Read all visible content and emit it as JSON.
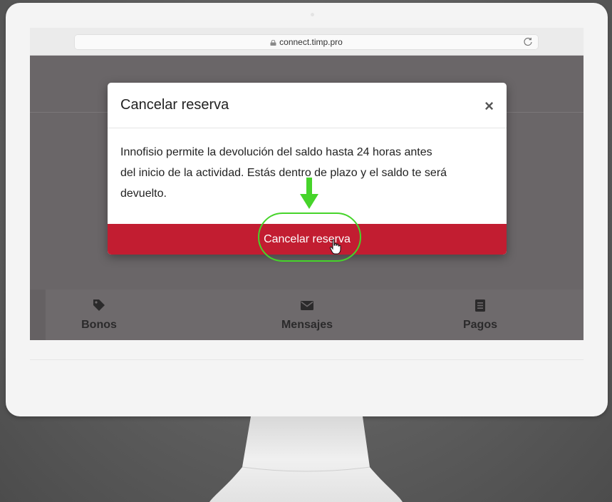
{
  "browser": {
    "url": "connect.timp.pro",
    "lock_icon": "lock-icon",
    "reload_icon": "reload-icon"
  },
  "modal": {
    "title": "Cancelar reserva",
    "close_label": "×",
    "body_lines": [
      "Innofisio permite la devolución del saldo hasta 24 horas antes",
      "del inicio de la actividad. Estás dentro de plazo y el saldo te será",
      "devuelto."
    ],
    "confirm_label": "Cancelar reserva"
  },
  "bottom_nav": {
    "items": [
      {
        "label": "Bonos",
        "icon": "tag-icon"
      },
      {
        "label": "Mensajes",
        "icon": "envelope-icon"
      },
      {
        "label": "Pagos",
        "icon": "list-icon"
      }
    ]
  },
  "colors": {
    "accent_red": "#c21d31",
    "highlight_green": "#46d42a",
    "overlay": "#6a6668"
  }
}
